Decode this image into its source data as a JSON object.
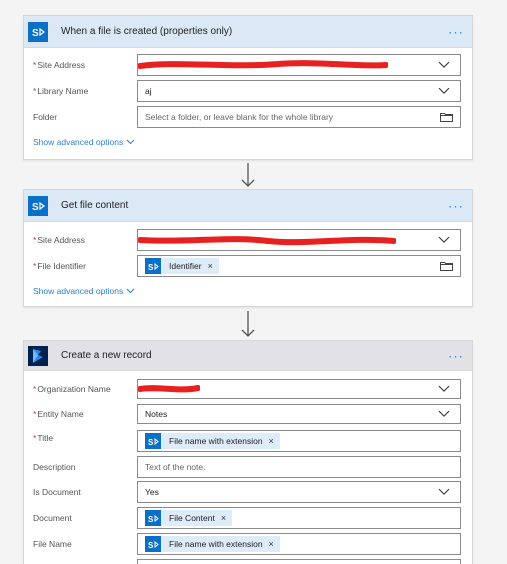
{
  "cards": [
    {
      "title": "When a file is created (properties only)",
      "more": "···",
      "fields": {
        "site_address": {
          "label": "Site Address",
          "required": "*"
        },
        "library_name": {
          "label": "Library Name",
          "required": "*",
          "value": "aj"
        },
        "folder": {
          "label": "Folder",
          "placeholder": "Select a folder, or leave blank for the whole library"
        }
      },
      "advanced": "Show advanced options"
    },
    {
      "title": "Get file content",
      "more": "···",
      "fields": {
        "site_address": {
          "label": "Site Address",
          "required": "*"
        },
        "file_identifier": {
          "label": "File Identifier",
          "required": "*",
          "token": "Identifier"
        }
      },
      "advanced": "Show advanced options"
    },
    {
      "title": "Create a new record",
      "more": "···",
      "fields": {
        "organization_name": {
          "label": "Organization Name",
          "required": "*"
        },
        "entity_name": {
          "label": "Entity Name",
          "required": "*",
          "value": "Notes"
        },
        "title": {
          "label": "Title",
          "required": "*",
          "token": "File name with extension"
        },
        "description": {
          "label": "Description",
          "placeholder": "Text of the note."
        },
        "is_document": {
          "label": "Is Document",
          "value": "Yes"
        },
        "document": {
          "label": "Document",
          "token": "File Content"
        },
        "file_name": {
          "label": "File Name",
          "token": "File name with extension"
        }
      }
    }
  ],
  "token_close": "×",
  "icons": {
    "sharepoint": "sharepoint-icon",
    "dynamics": "dynamics-icon"
  },
  "colors": {
    "sharepoint_blue": "#0a6fc7",
    "dynamics_navy": "#002050",
    "link_blue": "#2a7fd4",
    "required_red": "#c33",
    "redaction_red": "#e8201f"
  }
}
